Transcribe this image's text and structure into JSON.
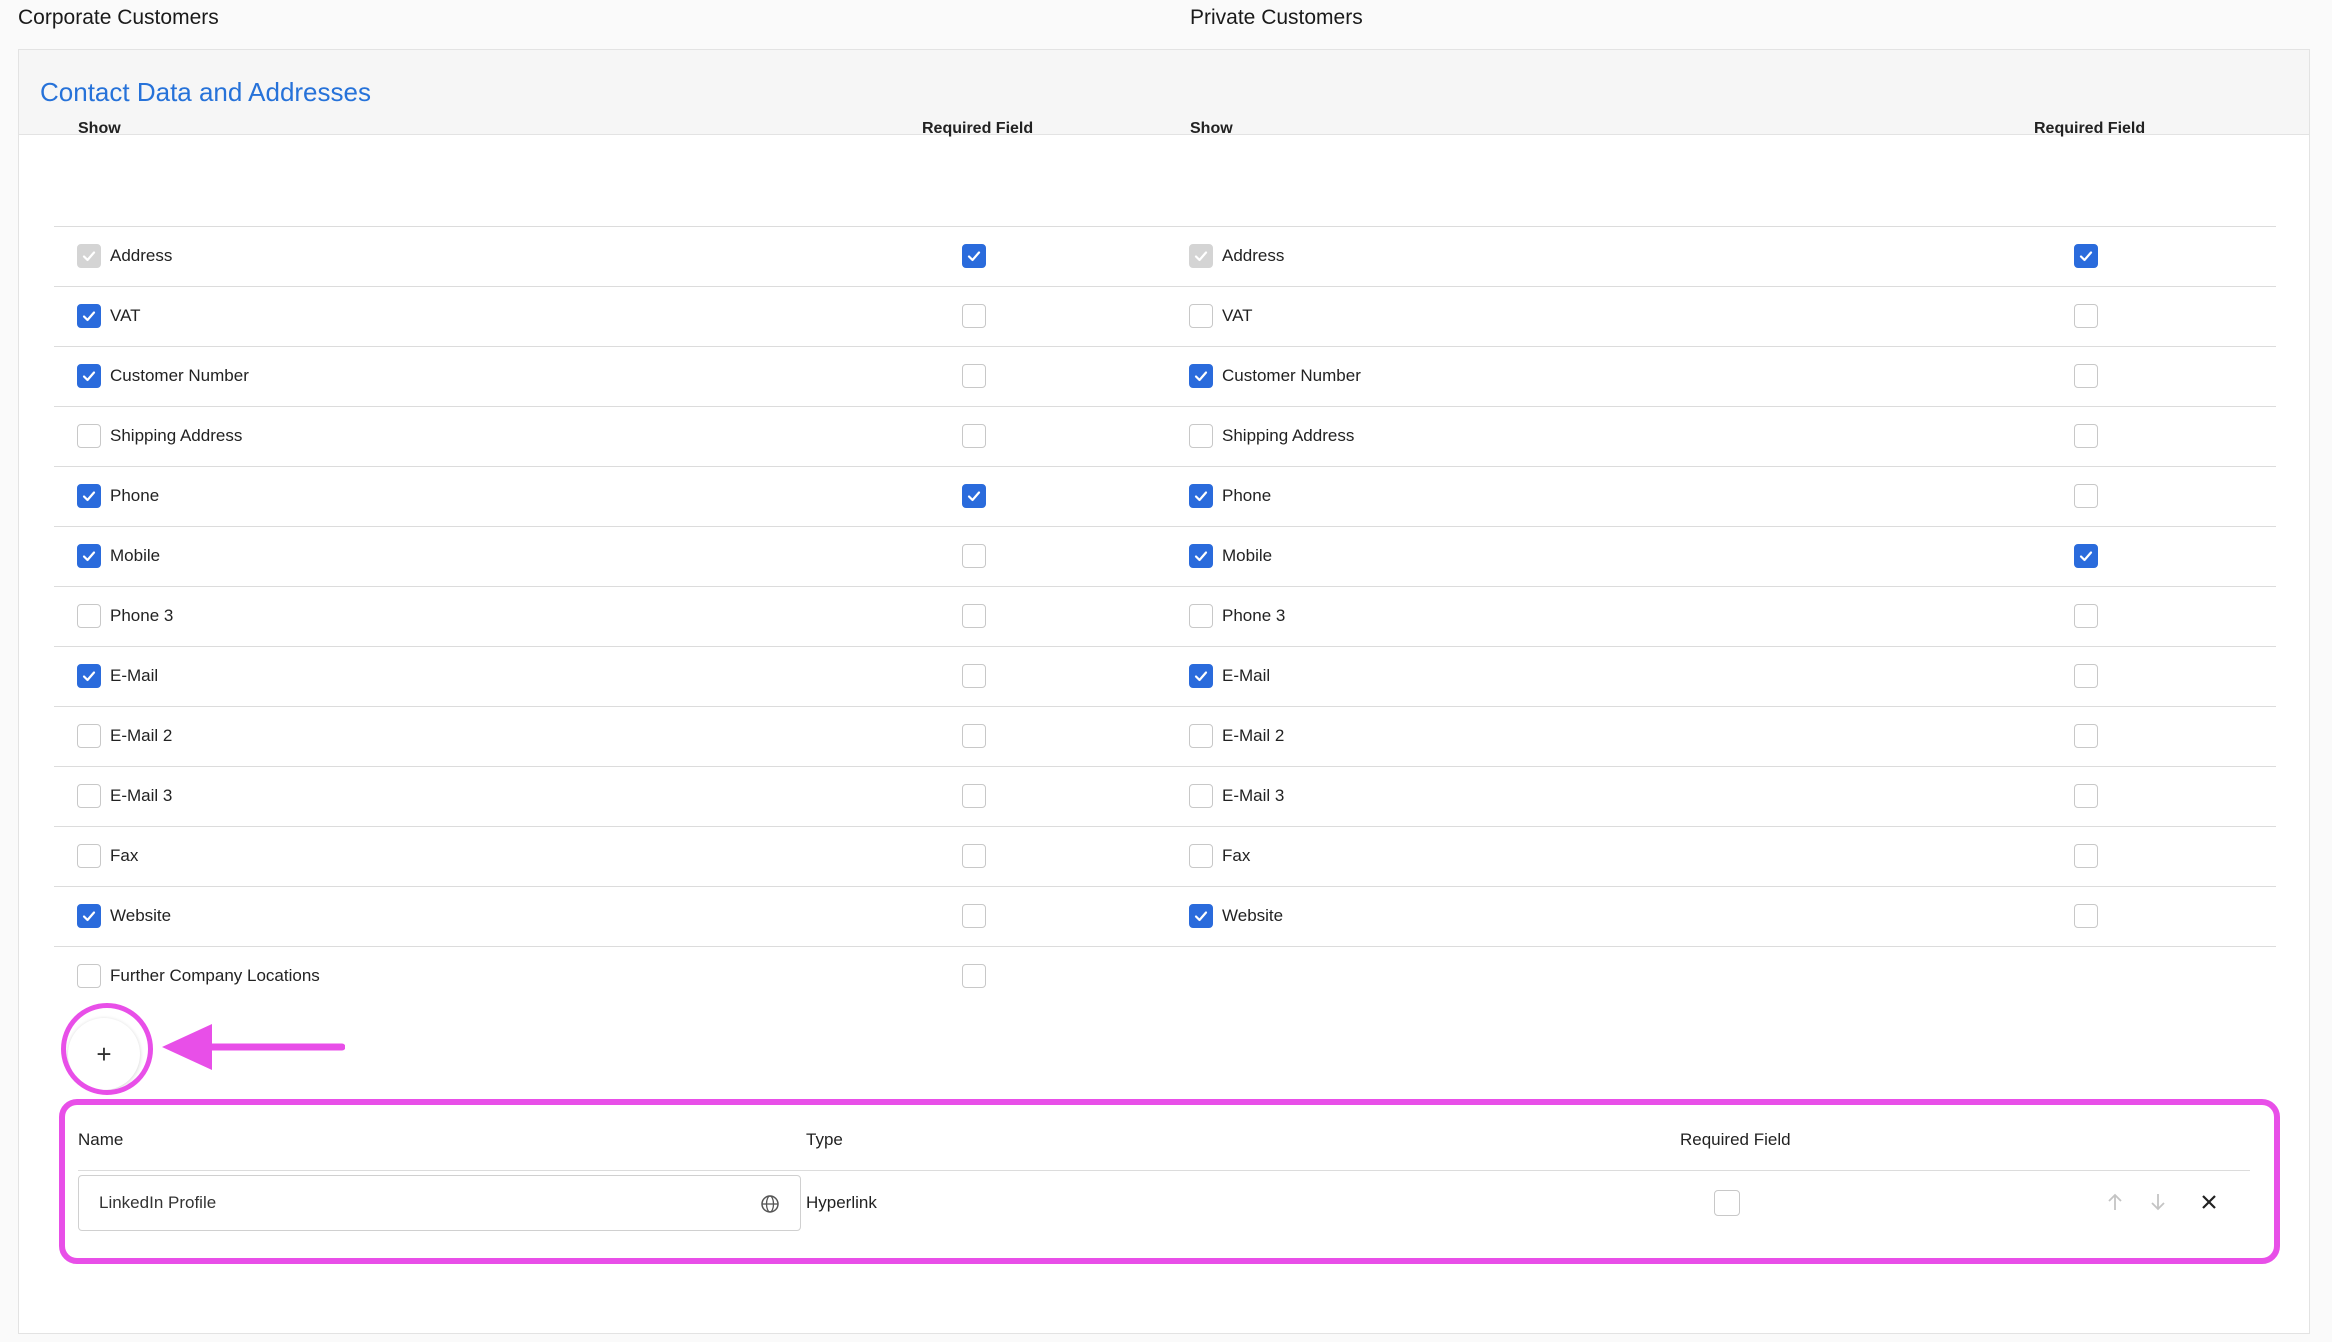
{
  "headings": {
    "corporate": "Corporate Customers",
    "private": "Private Customers"
  },
  "section_title": "Contact Data and Addresses",
  "columns": {
    "show": "Show",
    "required": "Required Field"
  },
  "corporate_rows": [
    {
      "label": "Address",
      "show": "disabled-checked",
      "required": true
    },
    {
      "label": "VAT",
      "show": true,
      "required": false
    },
    {
      "label": "Customer Number",
      "show": true,
      "required": false
    },
    {
      "label": "Shipping Address",
      "show": false,
      "required": false
    },
    {
      "label": "Phone",
      "show": true,
      "required": true
    },
    {
      "label": "Mobile",
      "show": true,
      "required": false
    },
    {
      "label": "Phone 3",
      "show": false,
      "required": false
    },
    {
      "label": "E-Mail",
      "show": true,
      "required": false
    },
    {
      "label": "E-Mail 2",
      "show": false,
      "required": false
    },
    {
      "label": "E-Mail 3",
      "show": false,
      "required": false
    },
    {
      "label": "Fax",
      "show": false,
      "required": false
    },
    {
      "label": "Website",
      "show": true,
      "required": false
    },
    {
      "label": "Further Company Locations",
      "show": false,
      "required": false
    }
  ],
  "private_rows": [
    {
      "label": "Address",
      "show": "disabled-checked",
      "required": true
    },
    {
      "label": "VAT",
      "show": false,
      "required": false
    },
    {
      "label": "Customer Number",
      "show": true,
      "required": false
    },
    {
      "label": "Shipping Address",
      "show": false,
      "required": false
    },
    {
      "label": "Phone",
      "show": true,
      "required": false
    },
    {
      "label": "Mobile",
      "show": true,
      "required": true
    },
    {
      "label": "Phone 3",
      "show": false,
      "required": false
    },
    {
      "label": "E-Mail",
      "show": true,
      "required": false
    },
    {
      "label": "E-Mail 2",
      "show": false,
      "required": false
    },
    {
      "label": "E-Mail 3",
      "show": false,
      "required": false
    },
    {
      "label": "Fax",
      "show": false,
      "required": false
    },
    {
      "label": "Website",
      "show": true,
      "required": false
    }
  ],
  "add_button": "+",
  "custom_field": {
    "headers": {
      "name": "Name",
      "type": "Type",
      "required": "Required Field"
    },
    "name_value": "LinkedIn Profile",
    "type": "Hyperlink",
    "required": false,
    "icons": [
      "globe-icon",
      "arrow-up-icon",
      "arrow-down-icon",
      "close-icon"
    ]
  },
  "colors": {
    "accent": "#2a6bdc",
    "title": "#2672d9",
    "highlight": "#e84fe8"
  }
}
